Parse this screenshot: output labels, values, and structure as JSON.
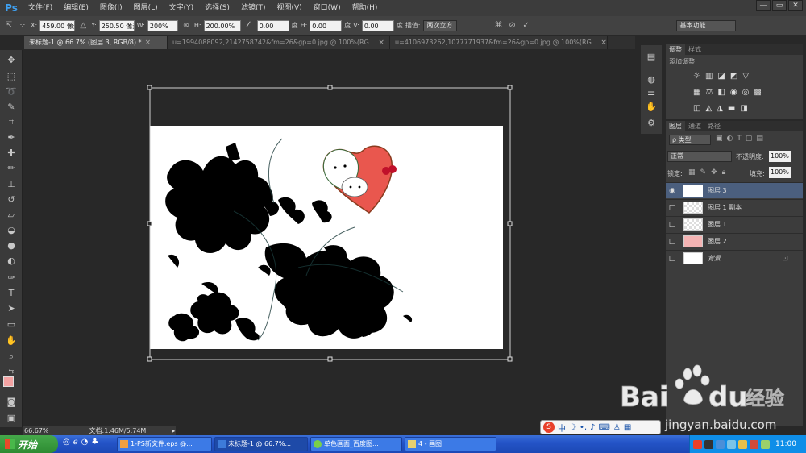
{
  "app": {
    "logo": "Ps"
  },
  "menu": [
    "文件(F)",
    "编辑(E)",
    "图像(I)",
    "图层(L)",
    "文字(Y)",
    "选择(S)",
    "滤镜(T)",
    "视图(V)",
    "窗口(W)",
    "帮助(H)"
  ],
  "window_controls": {
    "minimize": "—",
    "restore": "▭",
    "close": "✕"
  },
  "options": {
    "x_label": "X:",
    "x_value": "459.00 像素",
    "y_label": "Y:",
    "y_value": "250.50 像素",
    "w_label": "W:",
    "w_value": "200%",
    "h_label": "H:",
    "h_value": "200.00%",
    "angle_value": "0.00",
    "angle_unit": "度",
    "hskew_label": "H:",
    "hskew_value": "0.00",
    "hskew_unit": "度",
    "vskew_label": "V:",
    "vskew_value": "0.00",
    "vskew_unit": "度",
    "interp_label": "插值:",
    "interp_value": "两次立方",
    "workspace": "基本功能"
  },
  "tabs": [
    {
      "label": "未标题-1 @ 66.7% (图层 3, RGB/8) *",
      "active": true
    },
    {
      "label": "u=1994088092,2142758742&fm=26&gp=0.jpg @ 100%(RG...",
      "active": false
    },
    {
      "label": "u=4106973262,1077771937&fm=26&gp=0.jpg @ 100%(RG...",
      "active": false
    }
  ],
  "adjust_panel": {
    "tab1": "调整",
    "tab2": "样式",
    "heading": "添加调整"
  },
  "layers_panel": {
    "tab1": "图层",
    "tab2": "通道",
    "tab3": "路径",
    "filter": "ρ 类型",
    "blend_mode": "正常",
    "opacity_label": "不透明度:",
    "opacity_value": "100%",
    "lock_label": "锁定:",
    "fill_label": "填充:",
    "fill_value": "100%",
    "layers": [
      {
        "name": "图层 3",
        "visible": true,
        "selected": true
      },
      {
        "name": "图层 1 副本",
        "visible": false,
        "selected": false
      },
      {
        "name": "图层 1",
        "visible": false,
        "selected": false
      },
      {
        "name": "图层 2",
        "visible": false,
        "selected": false
      },
      {
        "name": "背景",
        "visible": false,
        "selected": false,
        "locked": true
      }
    ]
  },
  "status": {
    "zoom": "66.67%",
    "doc": "文档:1.46M/5.74M"
  },
  "taskbar": {
    "start": "开始",
    "tasks": [
      {
        "label": "1-PS新文件.eps @..."
      },
      {
        "label": "未标题-1 @ 66.7%..."
      },
      {
        "label": "单色画面_百度图..."
      },
      {
        "label": "4 - 画图"
      }
    ],
    "clock": "11:00"
  },
  "ime": {
    "label": "中"
  },
  "watermark": {
    "brand": "Bai",
    "brand2": "du",
    "suffix": "经验",
    "url": "jingyan.baidu.com"
  },
  "colors": {
    "foreground": "#f4a3a3",
    "background": "#ffffff",
    "selected_layer": "#4b5f7e"
  }
}
